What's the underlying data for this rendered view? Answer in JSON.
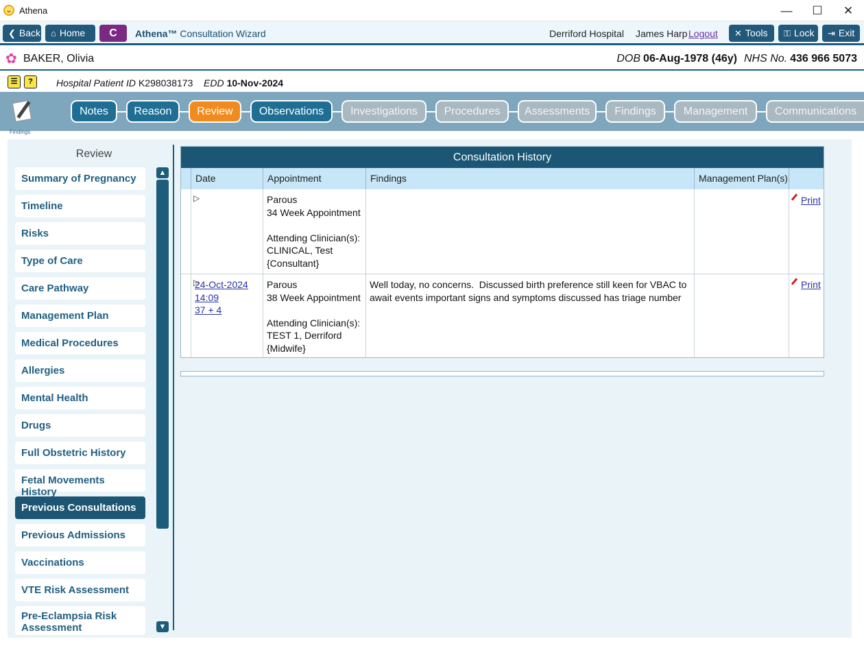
{
  "window": {
    "title": "Athena",
    "minimize": "—",
    "maximize": "☐",
    "close": "✕"
  },
  "toolbar": {
    "back": "Back",
    "home": "Home",
    "c_button": "C",
    "wizard_brand": "Athena™",
    "wizard_title": "Consultation Wizard",
    "hospital": "Derriford Hospital",
    "user": "James Harp",
    "logout": "Logout",
    "tools": "Tools",
    "lock": "Lock",
    "exit": "Exit"
  },
  "patient": {
    "name": "BAKER, Olivia",
    "dob_label": "DOB",
    "dob": "06-Aug-1978 (46y)",
    "nhs_label": "NHS No.",
    "nhs": "436 966 5073",
    "hpid_label": "Hospital Patient ID",
    "hpid": "K298038173",
    "edd_label": "EDD",
    "edd": "10-Nov-2024"
  },
  "tabs": {
    "findings_icon_label": "Findings",
    "items": [
      {
        "label": "Notes",
        "state": "blue"
      },
      {
        "label": "Reason",
        "state": "blue"
      },
      {
        "label": "Review",
        "state": "active"
      },
      {
        "label": "Observations",
        "state": "blue"
      },
      {
        "label": "Investigations",
        "state": "gray"
      },
      {
        "label": "Procedures",
        "state": "gray"
      },
      {
        "label": "Assessments",
        "state": "gray"
      },
      {
        "label": "Findings",
        "state": "gray"
      },
      {
        "label": "Management",
        "state": "gray"
      },
      {
        "label": "Communications",
        "state": "gray"
      }
    ]
  },
  "sidebar": {
    "title": "Review",
    "items": [
      "Summary of Pregnancy",
      "Timeline",
      "Risks",
      "Type of Care",
      "Care Pathway",
      "Management Plan",
      "Medical Procedures",
      "Allergies",
      "Mental Health",
      "Drugs",
      "Full Obstetric History",
      "Fetal Movements History",
      "Previous Consultations",
      "Previous Admissions",
      "Vaccinations",
      "VTE Risk Assessment",
      "Pre-Eclampsia Risk Assessment"
    ],
    "active": "Previous Consultations"
  },
  "history": {
    "title": "Consultation History",
    "columns": [
      "Date",
      "Appointment",
      "Findings",
      "Management Plan(s)"
    ],
    "rows": [
      {
        "date": "",
        "time": "",
        "gestation": "",
        "appointment_type": "Parous",
        "appointment_name": "34 Week Appointment",
        "clinician_label": "Attending Clinician(s):",
        "clinician": "CLINICAL, Test",
        "clinician_role": "{Consultant}",
        "findings": "",
        "management": "",
        "print": "Print"
      },
      {
        "date": "24-Oct-2024",
        "time": "14:09",
        "gestation": "37 + 4",
        "appointment_type": "Parous",
        "appointment_name": "38 Week Appointment",
        "clinician_label": "Attending Clinician(s):",
        "clinician": "TEST 1, Derriford",
        "clinician_role": "{Midwife}",
        "findings": "Well today, no concerns.  Discussed birth preference still keen for VBAC to await events important signs and symptoms discussed has triage number",
        "management": "",
        "print": "Print"
      }
    ]
  }
}
